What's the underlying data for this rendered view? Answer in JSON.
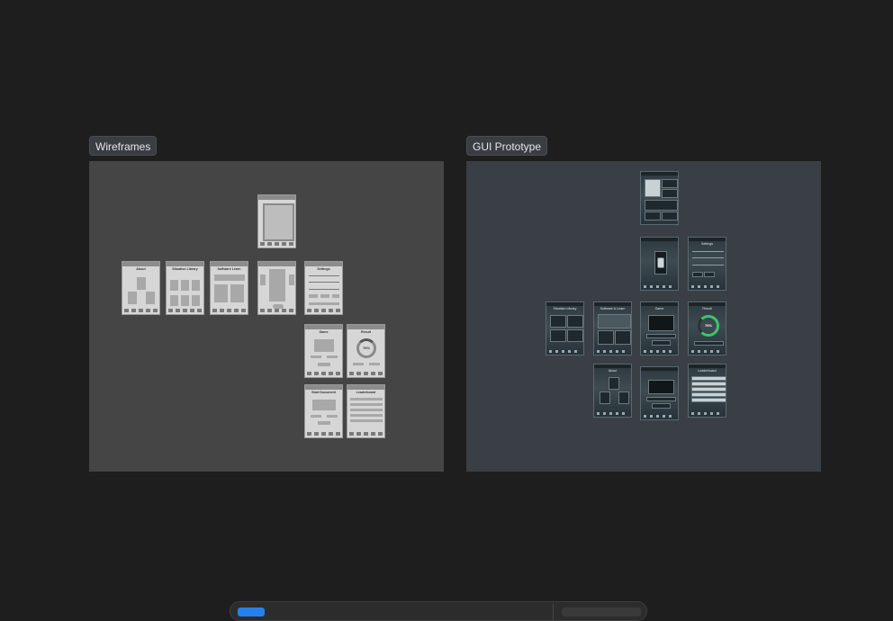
{
  "canvas": {
    "background": "#1e1e1e",
    "frames": [
      {
        "label": "Wireframes",
        "fill": "#454545"
      },
      {
        "label": "GUI Prototype",
        "fill": "#3a3f46"
      }
    ]
  },
  "wireframes": {
    "screens": [
      {
        "title": ""
      },
      {
        "title": "About"
      },
      {
        "title": "Situation Library"
      },
      {
        "title": "Software Learn"
      },
      {
        "title": ""
      },
      {
        "title": "Settings"
      },
      {
        "title": "Game"
      },
      {
        "title": "Result"
      },
      {
        "title": "Start Document"
      },
      {
        "title": "Leaderboard"
      }
    ],
    "result_percent": "76%"
  },
  "gui": {
    "screens": [
      {
        "title": ""
      },
      {
        "title": ""
      },
      {
        "title": "Settings"
      },
      {
        "title": "Situation Library"
      },
      {
        "title": "Software & Learn"
      },
      {
        "title": "Game"
      },
      {
        "title": "Result"
      },
      {
        "title": "About"
      },
      {
        "title": ""
      },
      {
        "title": "Leaderboard"
      }
    ],
    "result_percent": "76%"
  },
  "colors": {
    "accent": "#2680eb",
    "gauge_green": "#3ec46d",
    "label_bg": "#3a3d42"
  },
  "icons": [
    "toolbar-app-icon"
  ]
}
